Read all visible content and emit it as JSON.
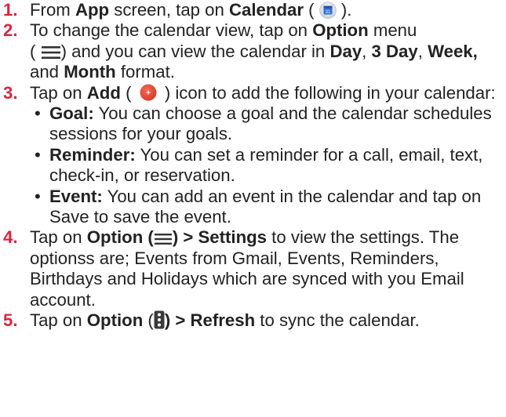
{
  "steps": [
    {
      "num": "1.",
      "t1": "From ",
      "b1": "App",
      "t2": " screen, tap on ",
      "b2": "Calendar",
      "t3": " (",
      "icon_text": "31",
      "t4": ")."
    },
    {
      "num": "2.",
      "t1": "To change the calendar view, tap on ",
      "b1": "Option",
      "t2": " menu",
      "t3": "(",
      "t4": ") and you can view the calendar in ",
      "b2": "Day",
      "t5": ", ",
      "b3": "3 Day",
      "t6": ", ",
      "b4": "Week,",
      "t7": " and ",
      "b5": "Month",
      "t8": " format."
    },
    {
      "num": "3.",
      "t1": "Tap on ",
      "b1": "Add",
      "t2": " (",
      "icon_text": "+",
      "t3": ") icon to add the following in your calendar:",
      "bullets": [
        {
          "label": "Goal:",
          "text": " You can choose a goal and the calendar schedules sessions for your goals."
        },
        {
          "label": "Reminder:",
          "text": " You can set a reminder for a call, email, text, check-in, or reservation."
        },
        {
          "label": "Event:",
          "text": " You can add an event in the calendar and tap on Save to save the event."
        }
      ]
    },
    {
      "num": "4.",
      "t1": "Tap on ",
      "b1": "Option (",
      "b2": ") > Settings",
      "t2": " to view the settings. The optionss are; Events from Gmail, Events, Reminders, Birthdays and Holidays which are  synced with you Email account."
    },
    {
      "num": "5.",
      "t1": "Tap on ",
      "b1": "Option",
      "t2": " (",
      "b2": ") > Refresh",
      "t3": " to sync the calendar."
    }
  ],
  "colors": {
    "step_number": "#d9253f",
    "text": "#222222",
    "calendar_icon": "#2f6fd6",
    "add_icon": "#e5412f"
  },
  "icons": [
    "calendar-icon",
    "menu-icon",
    "add-icon",
    "more-vert-icon"
  ]
}
